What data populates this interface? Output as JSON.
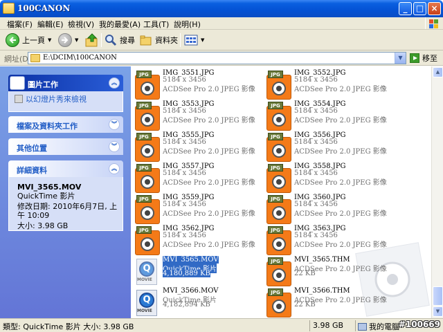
{
  "window": {
    "title": "100CANON",
    "minimize": "_",
    "maximize": "□",
    "close": "×"
  },
  "menu": [
    "檔案(F)",
    "編輯(E)",
    "檢視(V)",
    "我的最愛(A)",
    "工具(T)",
    "說明(H)"
  ],
  "toolbar": {
    "back_label": "上一頁",
    "search_label": "搜尋",
    "folders_label": "資料夾"
  },
  "address": {
    "label": "網址(D)",
    "path": "E:\\DCIM\\100CANON",
    "go_label": "移至"
  },
  "taskpane": {
    "picture_tasks": {
      "title": "圖片工作",
      "slideshow": "以幻燈片秀來檢視"
    },
    "file_tasks": {
      "title": "檔案及資料夾工作"
    },
    "other_places": {
      "title": "其他位置"
    },
    "details": {
      "title": "詳細資料",
      "name": "MVI_3565.MOV",
      "type": "QuickTime 影片",
      "modified": "修改日期: 2010年6月7日, 上午 10:09",
      "size": "大小: 3.98 GB"
    }
  },
  "files": [
    {
      "name": "IMG_3551.JPG",
      "dim": "5184 x 3456",
      "type": "ACDSee Pro 2.0 JPEG 影像",
      "icon": "jpg-icon"
    },
    {
      "name": "IMG_3552.JPG",
      "dim": "5184 x 3456",
      "type": "ACDSee Pro 2.0 JPEG 影像",
      "icon": "jpg-icon"
    },
    {
      "name": "IMG_3553.JPG",
      "dim": "5184 x 3456",
      "type": "ACDSee Pro 2.0 JPEG 影像",
      "icon": "jpg-icon"
    },
    {
      "name": "IMG_3554.JPG",
      "dim": "5184 x 3456",
      "type": "ACDSee Pro 2.0 JPEG 影像",
      "icon": "jpg-icon"
    },
    {
      "name": "IMG_3555.JPG",
      "dim": "5184 x 3456",
      "type": "ACDSee Pro 2.0 JPEG 影像",
      "icon": "jpg-icon"
    },
    {
      "name": "IMG_3556.JPG",
      "dim": "5184 x 3456",
      "type": "ACDSee Pro 2.0 JPEG 影像",
      "icon": "jpg-icon"
    },
    {
      "name": "IMG_3557.JPG",
      "dim": "5184 x 3456",
      "type": "ACDSee Pro 2.0 JPEG 影像",
      "icon": "jpg-icon"
    },
    {
      "name": "IMG_3558.JPG",
      "dim": "5184 x 3456",
      "type": "ACDSee Pro 2.0 JPEG 影像",
      "icon": "jpg-icon"
    },
    {
      "name": "IMG_3559.JPG",
      "dim": "5184 x 3456",
      "type": "ACDSee Pro 2.0 JPEG 影像",
      "icon": "jpg-icon"
    },
    {
      "name": "IMG_3560.JPG",
      "dim": "5184 x 3456",
      "type": "ACDSee Pro 2.0 JPEG 影像",
      "icon": "jpg-icon"
    },
    {
      "name": "IMG_3562.JPG",
      "dim": "5184 x 3456",
      "type": "ACDSee Pro 2.0 JPEG 影像",
      "icon": "jpg-icon"
    },
    {
      "name": "IMG_3563.JPG",
      "dim": "5184 x 3456",
      "type": "ACDSee Pro 2.0 JPEG 影像",
      "icon": "jpg-icon"
    },
    {
      "name": "MVI_3565.MOV",
      "dim": "QuickTime 影片",
      "type": "4,180,889 KB",
      "icon": "mov-icon",
      "selected": true
    },
    {
      "name": "MVI_3565.THM",
      "dim": "ACDSee Pro 2.0 JPEG 影像",
      "type": "22 KB",
      "icon": "jpg-icon"
    },
    {
      "name": "MVI_3566.MOV",
      "dim": "QuickTime 影片",
      "type": "4,182,894 KB",
      "icon": "mov-icon"
    },
    {
      "name": "MVI_3566.THM",
      "dim": "ACDSee Pro 2.0 JPEG 影像",
      "type": "22 KB",
      "icon": "jpg-icon"
    }
  ],
  "icon_text": {
    "jpg_badge": "JPG",
    "movie": "MOVIE",
    "quicktime": "Q"
  },
  "status": {
    "info": "類型: QuickTime 影片 大小: 3.98 GB",
    "size": "3.98 GB",
    "location": "我的電腦",
    "tag": "#100669"
  },
  "colors": {
    "titlebar": "#0a5fe0",
    "selection": "#316ac5",
    "taskpane": "#6375d6"
  }
}
